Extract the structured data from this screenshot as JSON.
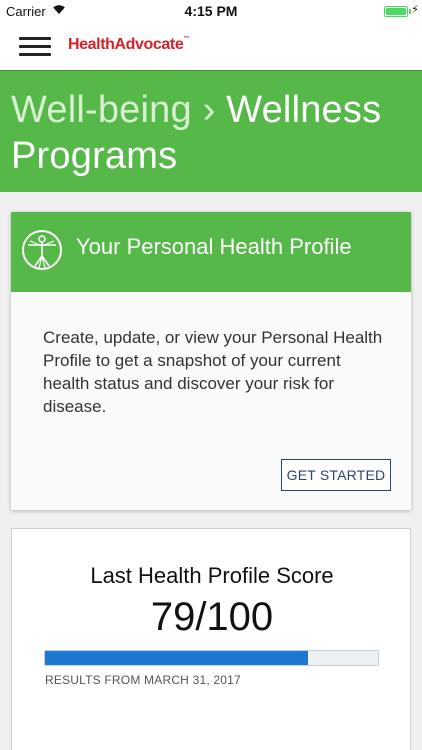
{
  "status_bar": {
    "carrier": "Carrier",
    "time": "4:15 PM",
    "charging_symbol": "⚡"
  },
  "nav": {
    "logo_text": "HealthAdvocate",
    "logo_tm": "™"
  },
  "banner": {
    "crumb": "Well-being ›",
    "title": "Wellness Programs"
  },
  "profile_card": {
    "title": "Your Personal Health Profile",
    "body": "Create, update, or view your Personal Health Profile to get a snapshot of your current health status and discover your risk for disease.",
    "button_label": "GET STARTED"
  },
  "score_card": {
    "title": "Last Health Profile Score",
    "score": "79/100",
    "score_value": 79,
    "score_max": 100,
    "results_date": "RESULTS FROM MARCH 31, 2017"
  },
  "colors": {
    "brand_green": "#55b848",
    "brand_red": "#d2232a",
    "progress_blue": "#1e78d2",
    "button_navy": "#2d4373"
  }
}
